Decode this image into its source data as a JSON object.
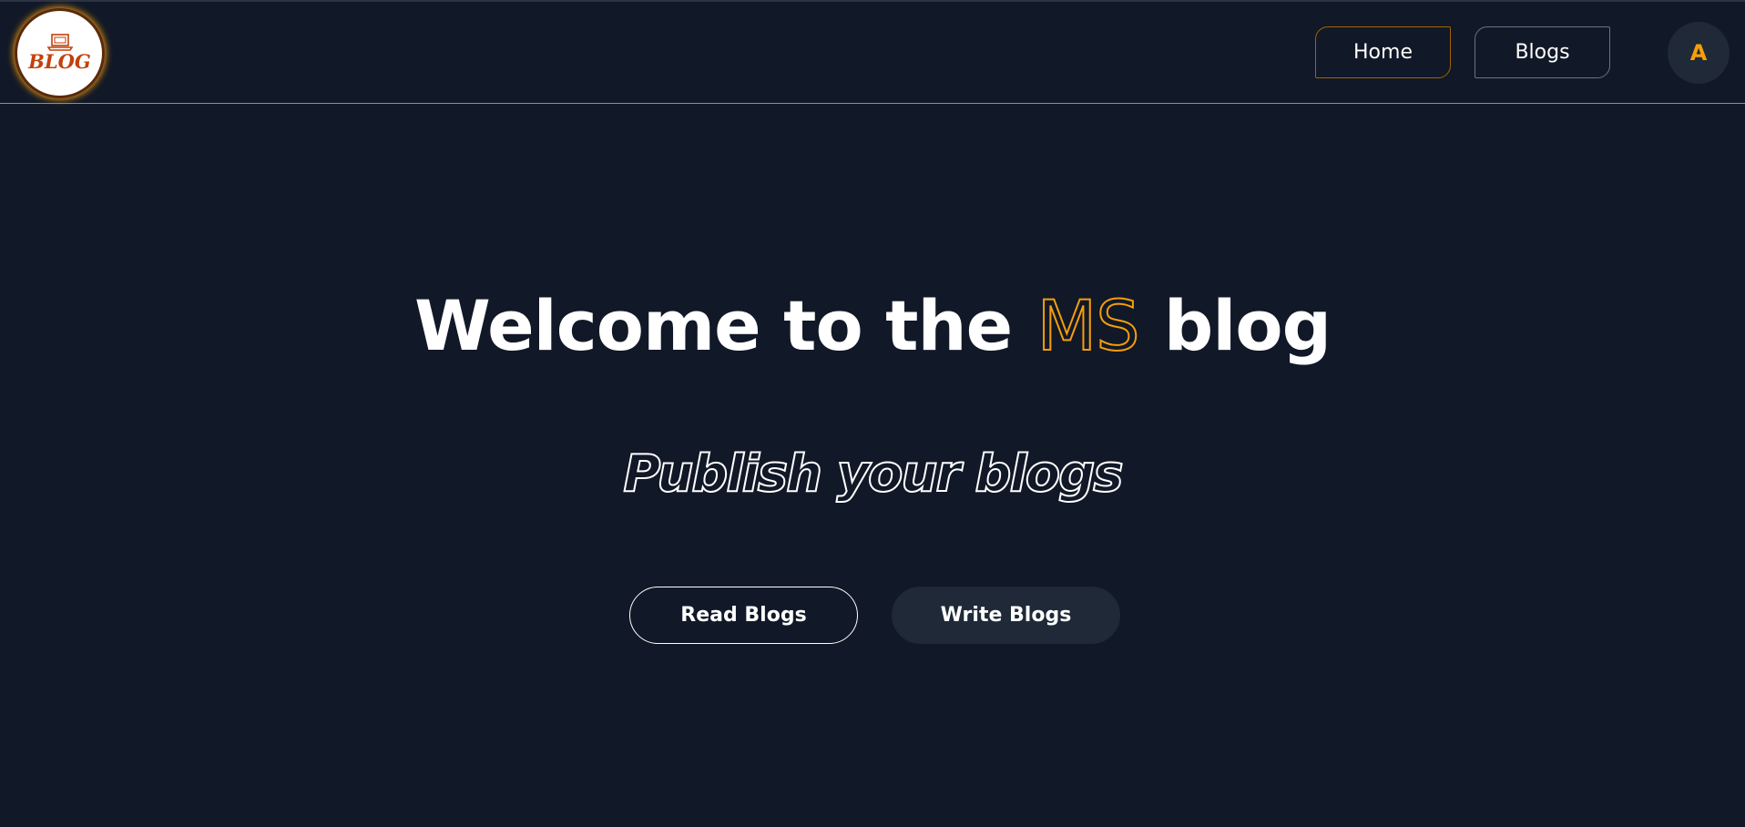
{
  "navbar": {
    "logo_text": "BLOG",
    "home_label": "Home",
    "blogs_label": "Blogs",
    "avatar_initial": "A"
  },
  "hero": {
    "title_prefix": "Welcome to the",
    "title_accent": "MS",
    "title_suffix": "blog",
    "tagline": "Publish your blogs"
  },
  "actions": {
    "read_label": "Read Blogs",
    "write_label": "Write Blogs"
  },
  "colors": {
    "background": "#111827",
    "accent": "#f59e0b",
    "button_dark": "#1f2937",
    "logo_red": "#c2410c"
  },
  "icons": {
    "logo_graphic": "laptop-icon"
  }
}
